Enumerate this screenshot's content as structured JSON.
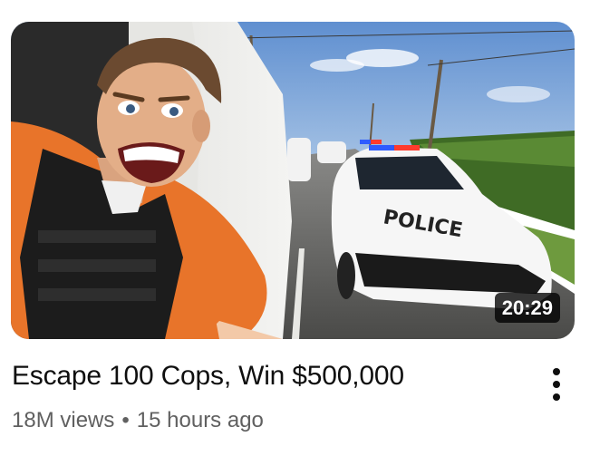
{
  "video": {
    "duration": "20:29",
    "title": "Escape 100 Cops, Win $500,000",
    "views": "18M views",
    "separator": "•",
    "age": "15 hours ago",
    "thumbnail_caption": "POLICE"
  },
  "icons": {
    "more": "more-vertical-icon"
  },
  "colors": {
    "title": "#0f0f0f",
    "meta": "#606060",
    "duration_bg": "#000000",
    "jumpsuit": "#e8742a",
    "sky": "#6f9fd8"
  }
}
